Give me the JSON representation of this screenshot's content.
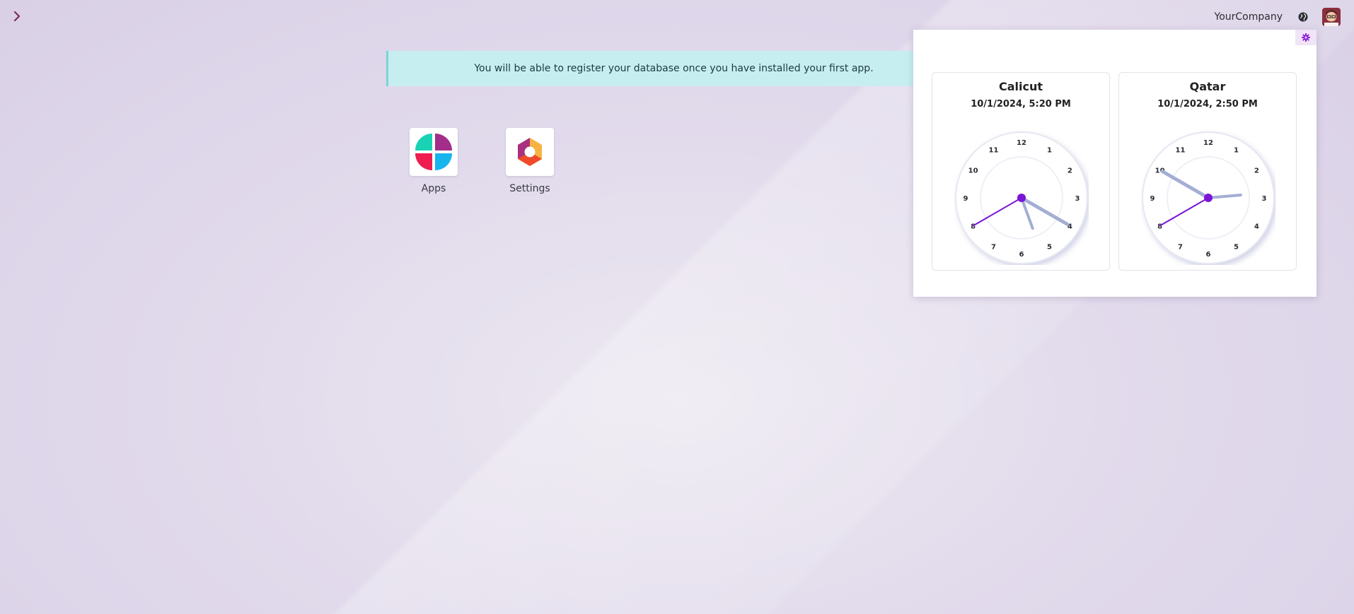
{
  "header": {
    "company": "YourCompany"
  },
  "banner": {
    "text": "You will be able to register your database once you have installed your first app."
  },
  "apps": [
    {
      "label": "Apps",
      "icon": "apps-icon"
    },
    {
      "label": "Settings",
      "icon": "settings-icon"
    }
  ],
  "clocks": [
    {
      "city": "Calicut",
      "datetime": "10/1/2024, 5:20 PM",
      "hour": 5,
      "minute": 20,
      "second": 40
    },
    {
      "city": "Qatar",
      "datetime": "10/1/2024, 2:50 PM",
      "hour": 2,
      "minute": 50,
      "second": 40
    }
  ],
  "clock_numbers": [
    "12",
    "1",
    "2",
    "3",
    "4",
    "5",
    "6",
    "7",
    "8",
    "9",
    "10",
    "11"
  ],
  "colors": {
    "accent": "#7e22ce",
    "second_hand": "#7a14d6",
    "hour_minute_hands": "#a4aed4",
    "banner_bg": "#c6eef0"
  }
}
